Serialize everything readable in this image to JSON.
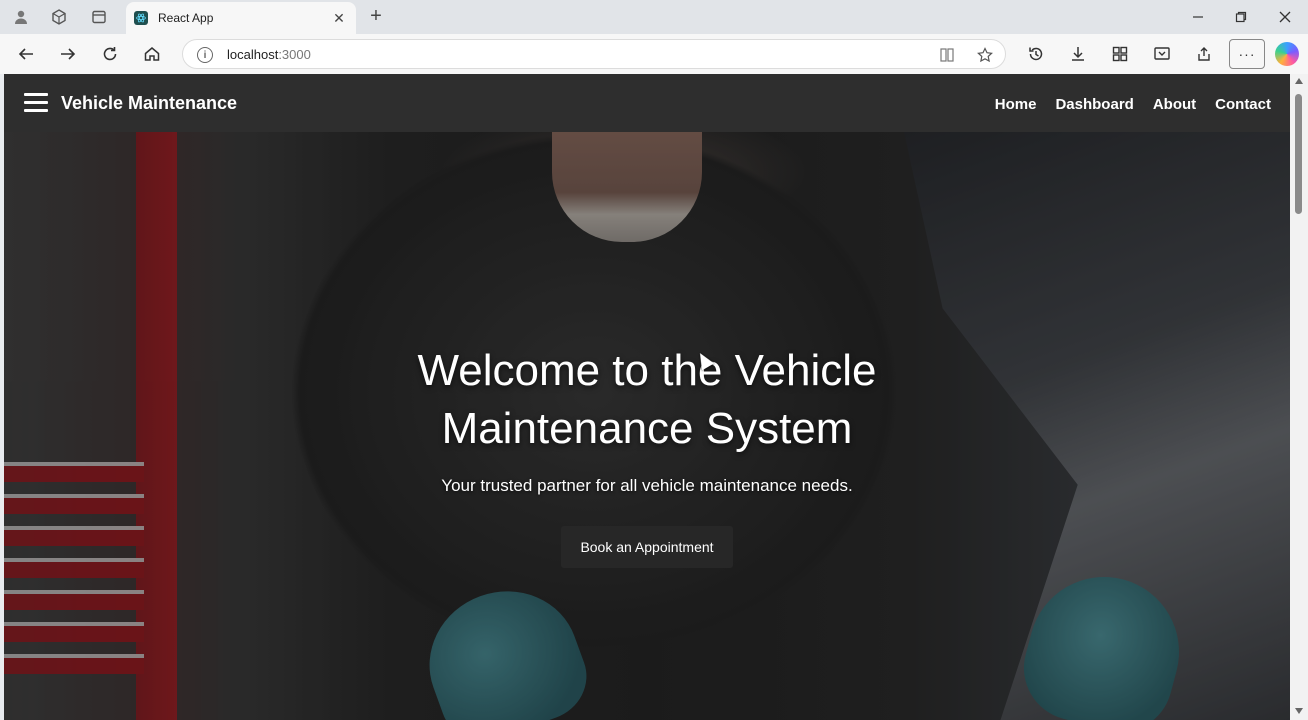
{
  "browser": {
    "tab": {
      "title": "React App",
      "favicon": "react-icon"
    },
    "address": {
      "host": "localhost",
      "port": ":3000"
    },
    "icons": {
      "profile": "profile-icon",
      "workspaces": "workspaces-icon",
      "tab_actions": "tab-actions-icon",
      "close_tab": "close-icon",
      "new_tab": "plus-icon",
      "minimize": "minimize-icon",
      "restore": "restore-icon",
      "close_window": "close-window-icon",
      "back": "back-arrow-icon",
      "forward": "forward-arrow-icon",
      "reload": "reload-icon",
      "home": "home-icon",
      "site_info": "info-icon",
      "reader": "reader-mode-icon",
      "favorite": "star-icon",
      "history": "history-icon",
      "downloads": "download-icon",
      "extensions": "extensions-icon",
      "screenshot": "screenshot-icon",
      "share": "share-icon",
      "more": "more-icon",
      "copilot": "copilot-icon"
    }
  },
  "app": {
    "brand": "Vehicle Maintenance",
    "nav": [
      "Home",
      "Dashboard",
      "About",
      "Contact"
    ],
    "hero": {
      "title": "Welcome to the Vehicle Maintenance System",
      "subtitle": "Your trusted partner for all vehicle maintenance needs.",
      "cta": "Book an Appointment"
    }
  }
}
